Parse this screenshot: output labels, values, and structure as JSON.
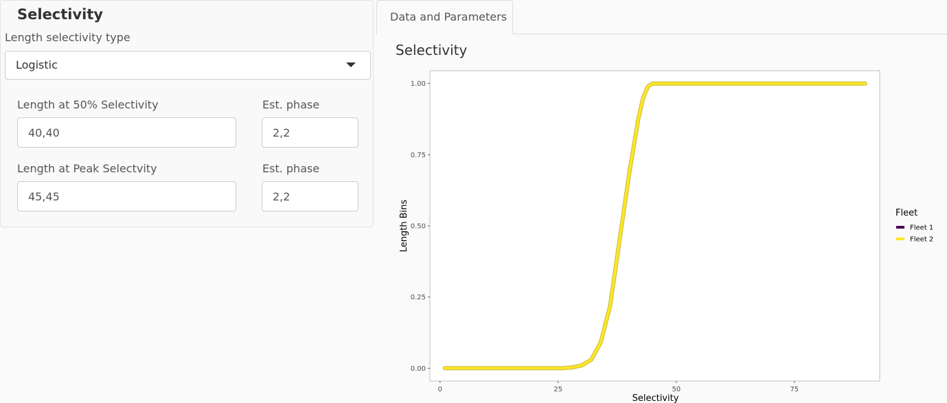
{
  "sidebar": {
    "title": "Selectivity",
    "select_label": "Length selectivity type",
    "select_value": "Logistic",
    "fields": [
      {
        "label": "Length at 50% Selectivity",
        "value": "40,40",
        "phase_label": "Est. phase",
        "phase_value": "2,2"
      },
      {
        "label": "Length at Peak Selectvity",
        "value": "45,45",
        "phase_label": "Est. phase",
        "phase_value": "2,2"
      }
    ]
  },
  "tabs": [
    {
      "label": "Data and Parameters"
    }
  ],
  "main": {
    "section_title": "Selectivity"
  },
  "chart_data": {
    "type": "line",
    "xlabel": "Selectivity",
    "ylabel": "Length Bins",
    "xlim": [
      0,
      90
    ],
    "ylim": [
      0,
      1
    ],
    "x_ticks": [
      "0",
      "25",
      "50",
      "75"
    ],
    "y_ticks": [
      "0.00",
      "0.25",
      "0.50",
      "0.75",
      "1.00"
    ],
    "grid": false,
    "legend_title": "Fleet",
    "legend_position": "right",
    "series": [
      {
        "name": "Fleet 1",
        "color": "#440154",
        "x": [
          1,
          10,
          20,
          26,
          28,
          30,
          32,
          34,
          36,
          38,
          40,
          42,
          43,
          44,
          45,
          50,
          60,
          70,
          80,
          90
        ],
        "values": [
          0,
          0,
          0,
          0,
          0.003,
          0.01,
          0.03,
          0.09,
          0.22,
          0.45,
          0.68,
          0.88,
          0.95,
          0.99,
          1,
          1,
          1,
          1,
          1,
          1
        ]
      },
      {
        "name": "Fleet 2",
        "color": "#fde725",
        "x": [
          1,
          10,
          20,
          26,
          28,
          30,
          32,
          34,
          36,
          38,
          40,
          42,
          43,
          44,
          45,
          50,
          60,
          70,
          80,
          90
        ],
        "values": [
          0,
          0,
          0,
          0,
          0.003,
          0.01,
          0.03,
          0.09,
          0.22,
          0.45,
          0.68,
          0.88,
          0.95,
          0.99,
          1,
          1,
          1,
          1,
          1,
          1
        ]
      }
    ]
  }
}
